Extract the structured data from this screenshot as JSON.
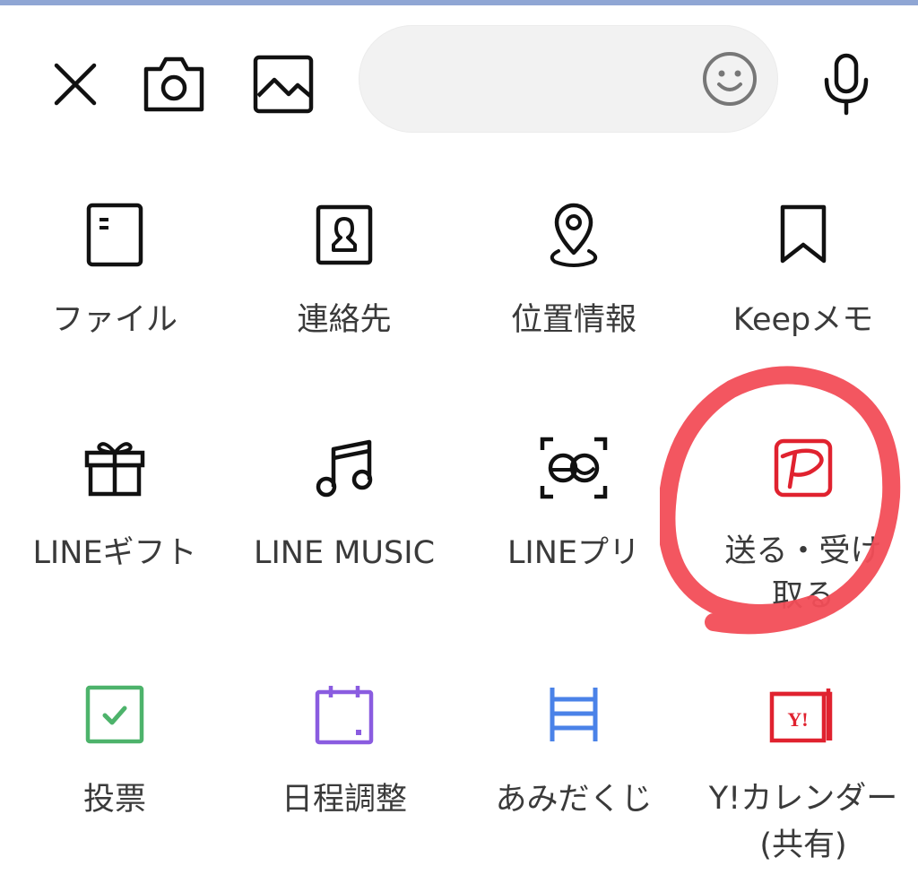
{
  "toolbar": {
    "close_icon": "close-icon",
    "camera_icon": "camera-icon",
    "image_icon": "image-icon",
    "message_input": {
      "value": "",
      "placeholder": ""
    },
    "emoji_icon": "emoji-icon",
    "mic_icon": "microphone-icon"
  },
  "menu": {
    "items": [
      {
        "label": "ファイル",
        "icon": "file-icon"
      },
      {
        "label": "連絡先",
        "icon": "contact-icon"
      },
      {
        "label": "位置情報",
        "icon": "location-pin-icon"
      },
      {
        "label": "Keepメモ",
        "icon": "bookmark-icon"
      },
      {
        "label": "LINEギフト",
        "icon": "gift-icon"
      },
      {
        "label": "LINE MUSIC",
        "icon": "music-note-icon"
      },
      {
        "label": "LINEプリ",
        "icon": "photo-booth-icon"
      },
      {
        "label": "送る・受け\n取る",
        "icon": "paypay-icon"
      },
      {
        "label": "投票",
        "icon": "vote-checkbox-icon"
      },
      {
        "label": "日程調整",
        "icon": "calendar-icon"
      },
      {
        "label": "あみだくじ",
        "icon": "ladder-lottery-icon"
      },
      {
        "label": "Y!カレンダー\n(共有)",
        "icon": "yahoo-calendar-icon"
      }
    ]
  },
  "colors": {
    "accent_bar": "#8fa6d4",
    "input_bg": "#f2f2f2",
    "highlight": "#f24d57",
    "vote": "#4db36b",
    "schedule": "#8a5ce0",
    "amidakuji": "#4a82e8",
    "yahoo": "#e0222f"
  }
}
